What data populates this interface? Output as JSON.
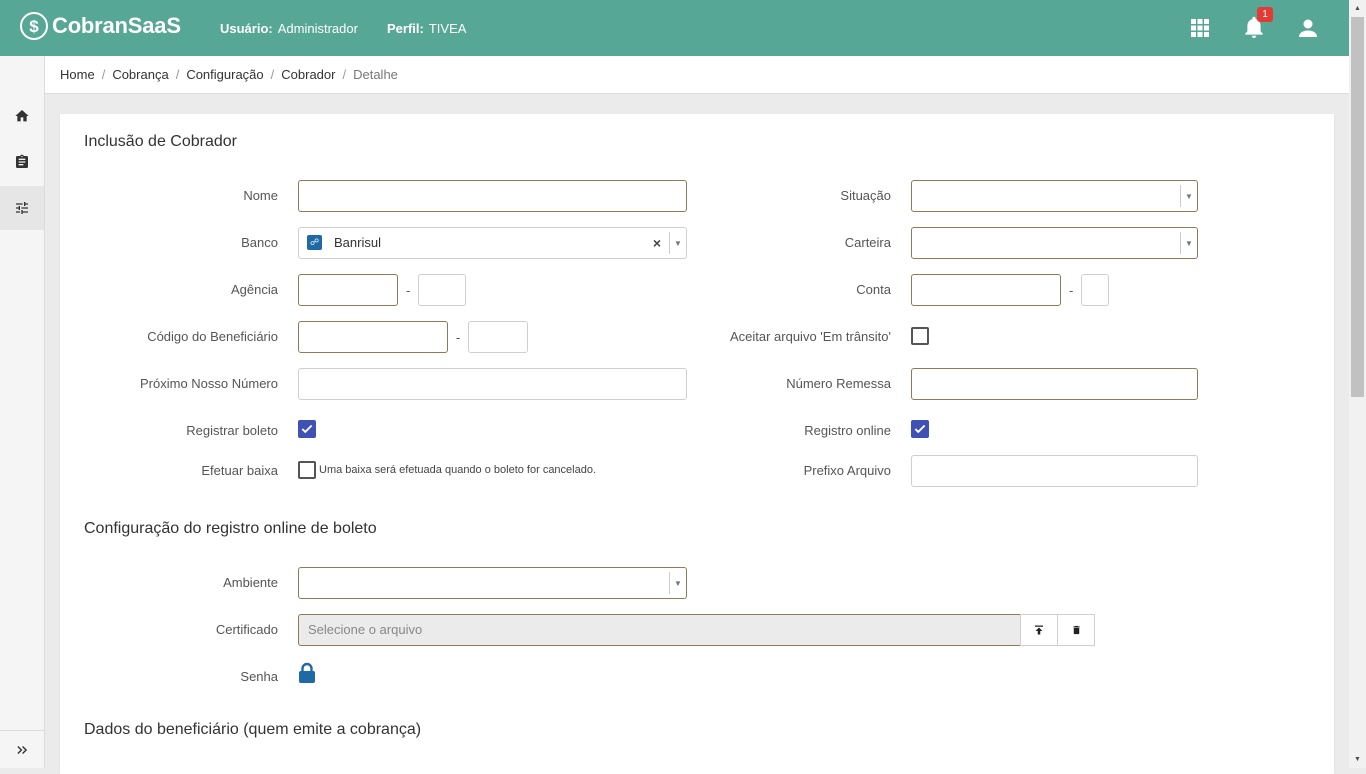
{
  "header": {
    "logo_text": "CobranSaaS",
    "user_label": "Usuário:",
    "user_value": "Administrador",
    "profile_label": "Perfil:",
    "profile_value": "TIVEA",
    "notification_count": "1",
    "color": "#57a796"
  },
  "breadcrumb": {
    "items": [
      "Home",
      "Cobrança",
      "Configuração",
      "Cobrador",
      "Detalhe"
    ],
    "separator": "/"
  },
  "form": {
    "title": "Inclusão de Cobrador",
    "nome_label": "Nome",
    "nome_value": "",
    "banco_label": "Banco",
    "banco_value": "Banrisul",
    "agencia_label": "Agência",
    "codigo_label": "Código do Beneficiário",
    "proximo_label": "Próximo Nosso Número",
    "registrar_label": "Registrar boleto",
    "registrar_checked": true,
    "efetuar_label": "Efetuar baixa",
    "efetuar_checked": false,
    "efetuar_hint": "Uma baixa será efetuada quando o boleto for cancelado.",
    "situacao_label": "Situação",
    "carteira_label": "Carteira",
    "conta_label": "Conta",
    "aceitar_label": "Aceitar arquivo 'Em trânsito'",
    "aceitar_checked": false,
    "numero_label": "Número Remessa",
    "registro_online_label": "Registro online",
    "registro_online_checked": true,
    "prefixo_label": "Prefixo Arquivo",
    "dash": "-"
  },
  "online": {
    "title": "Configuração do registro online de boleto",
    "ambiente_label": "Ambiente",
    "certificado_label": "Certificado",
    "certificado_placeholder": "Selecione o arquivo",
    "senha_label": "Senha"
  },
  "beneficiario": {
    "title": "Dados do beneficiário (quem emite a cobrança)"
  },
  "icons": {
    "apps": "apps-grid-icon",
    "bell": "bell-icon",
    "user": "user-icon",
    "home": "home-icon",
    "clipboard": "clipboard-icon",
    "settings": "tune-icon",
    "expand": "chevron-double-right-icon",
    "upload": "upload-icon",
    "trash": "trash-icon",
    "lock": "lock-icon",
    "checkbox_color": "#3f51b5",
    "lock_color": "#1f6aa5"
  }
}
